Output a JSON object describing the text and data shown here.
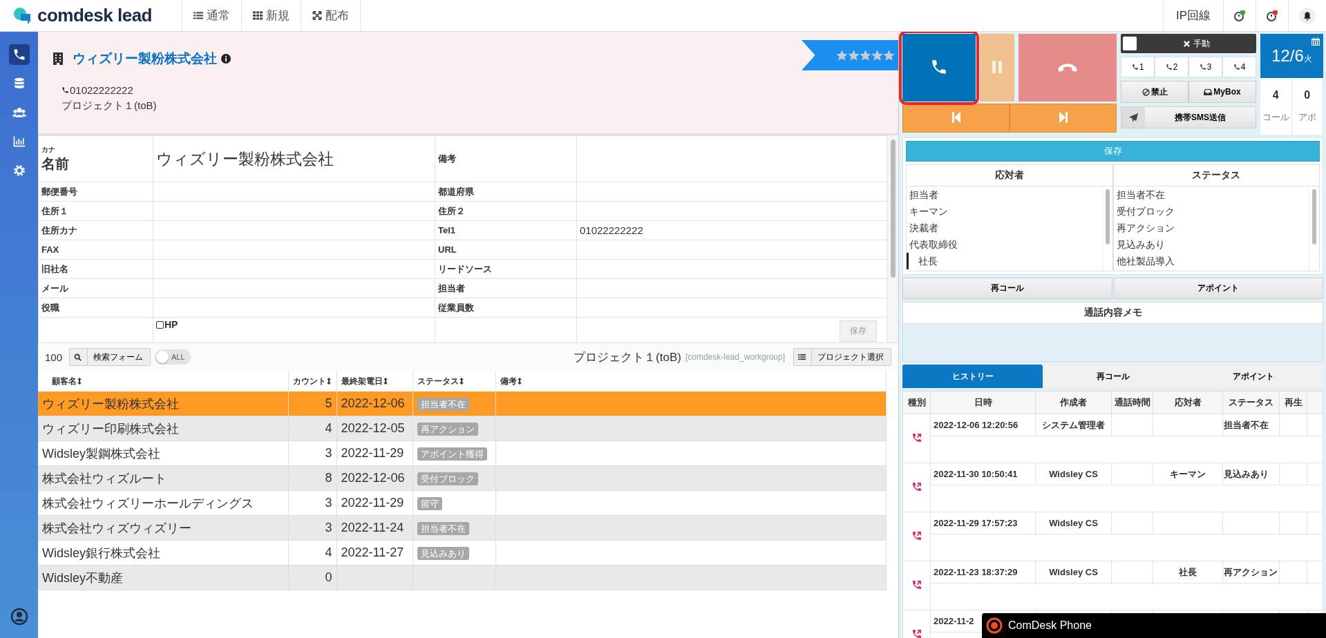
{
  "nav": {
    "brand": "comdesk lead",
    "tabs": [
      {
        "label": "通常",
        "kind": "list"
      },
      {
        "label": "新規",
        "kind": "grid"
      },
      {
        "label": "配布",
        "kind": "expand"
      }
    ],
    "line": "IP回線"
  },
  "sidebar": [
    {
      "kind": "phone",
      "selected": true
    },
    {
      "kind": "database",
      "selected": false
    },
    {
      "kind": "users",
      "selected": false
    },
    {
      "kind": "chart",
      "selected": false
    },
    {
      "kind": "gear",
      "selected": false
    }
  ],
  "record": {
    "company": "ウィズリー製粉株式会社",
    "phone": "01022222222",
    "project": "プロジェクト１(toB)",
    "stars": 5
  },
  "form": {
    "kana_label": "カナ",
    "name_label": "名前",
    "name_value": "ウィズリー製粉株式会社",
    "note_label": "備考",
    "rows": [
      {
        "left": {
          "label": "郵便番号"
        },
        "right": {
          "label": "都道府県"
        }
      },
      {
        "left": {
          "label": "住所１"
        },
        "right": {
          "label": "住所２"
        }
      },
      {
        "left": {
          "label": "住所カナ"
        },
        "right": {
          "label": "Tel1",
          "value": "01022222222"
        }
      },
      {
        "left": {
          "label": "FAX"
        },
        "right": {
          "label": "URL"
        }
      },
      {
        "left": {
          "label": "旧社名"
        },
        "right": {
          "label": "リードソース"
        }
      },
      {
        "left": {
          "label": "メール"
        },
        "right": {
          "label": "担当者"
        }
      },
      {
        "left": {
          "label": "役職"
        },
        "right": {
          "label": "従業員数"
        }
      }
    ],
    "checkbox": {
      "label": "HP",
      "checked": false
    },
    "save_button": "保存"
  },
  "toolbar": {
    "count": "100",
    "search_button": "検索フォーム",
    "toggle": {
      "label": "ALL",
      "on": false
    },
    "project": "プロジェクト１(toB)",
    "group": "[comdesk-lead_workgroup]",
    "select_button": "プロジェクト選択"
  },
  "list": {
    "columns": [
      "顧客名",
      "カウント",
      "最終架電日",
      "ステータス",
      "備考"
    ],
    "rows": [
      {
        "name": "ウィズリー製粉株式会社",
        "count": "5",
        "date": "2022-12-06",
        "status": "担当者不在",
        "selected": true
      },
      {
        "name": "ウィズリー印刷株式会社",
        "count": "4",
        "date": "2022-12-05",
        "status": "再アクション",
        "selected": false
      },
      {
        "name": "Widsley製鋼株式会社",
        "count": "3",
        "date": "2022-11-29",
        "status": "アポイント獲得",
        "selected": false
      },
      {
        "name": "株式会社ウィズルート",
        "count": "8",
        "date": "2022-12-06",
        "status": "受付ブロック",
        "selected": false
      },
      {
        "name": "株式会社ウィズリーホールディングス",
        "count": "3",
        "date": "2022-11-29",
        "status": "留守",
        "selected": false
      },
      {
        "name": "株式会社ウィズウィズリー",
        "count": "3",
        "date": "2022-11-24",
        "status": "担当者不在",
        "selected": false
      },
      {
        "name": "Widsley銀行株式会社",
        "count": "4",
        "date": "2022-11-27",
        "status": "見込みあり",
        "selected": false
      },
      {
        "name": "Widsley不動産",
        "count": "0",
        "selected": false
      }
    ]
  },
  "phone_panel": {
    "call_highlighted": true,
    "mode": {
      "label": "手動",
      "checked": false
    },
    "lines": [
      "1",
      "2",
      "3",
      "4"
    ],
    "block_button": "禁止",
    "mybox_button": "MyBox",
    "sms_button": "携帯SMS送信",
    "date": {
      "day": "12/6",
      "weekday": "火"
    },
    "stats": [
      {
        "value": "4",
        "label": "コール"
      },
      {
        "value": "0",
        "label": "アポ"
      }
    ]
  },
  "result": {
    "save_button": "保存",
    "responders": {
      "title": "応対者",
      "items": [
        {
          "label": "担当者",
          "selected": false
        },
        {
          "label": "キーマン",
          "selected": false
        },
        {
          "label": "決裁者",
          "selected": false
        },
        {
          "label": "代表取締役",
          "selected": false,
          "children": [
            {
              "label": "社長",
              "selected": true
            }
          ]
        }
      ]
    },
    "statuses": {
      "title": "ステータス",
      "items": [
        {
          "label": "担当者不在",
          "selected": false
        },
        {
          "label": "受付ブロック",
          "selected": false
        },
        {
          "label": "再アクション",
          "selected": false
        },
        {
          "label": "見込みあり",
          "selected": false
        },
        {
          "label": "他社製品導入",
          "selected": false
        }
      ]
    },
    "buttons": [
      "再コール",
      "アポイント"
    ],
    "memo_title": "通話内容メモ"
  },
  "history": {
    "tabs": [
      {
        "label": "ヒストリー",
        "selected": true
      },
      {
        "label": "再コール",
        "selected": false
      },
      {
        "label": "アポイント",
        "selected": false
      }
    ],
    "columns": [
      "種別",
      "日時",
      "作成者",
      "通話時間",
      "応対者",
      "ステータス",
      "再生"
    ],
    "rows": [
      {
        "datetime": "2022-12-06 12:20:56",
        "author": "システム管理者",
        "status": "担当者不在"
      },
      {
        "datetime": "2022-11-30 10:50:41",
        "author": "Widsley CS",
        "responder": "キーマン",
        "status": "見込みあり"
      },
      {
        "datetime": "2022-11-29 17:57:23",
        "author": "Widsley CS"
      },
      {
        "datetime": "2022-11-23 18:37:29",
        "author": "Widsley CS",
        "responder": "社長",
        "status": "再アクション"
      },
      {
        "datetime": "2022-11-2"
      }
    ]
  },
  "overlay": {
    "title": "ComDesk Phone"
  }
}
